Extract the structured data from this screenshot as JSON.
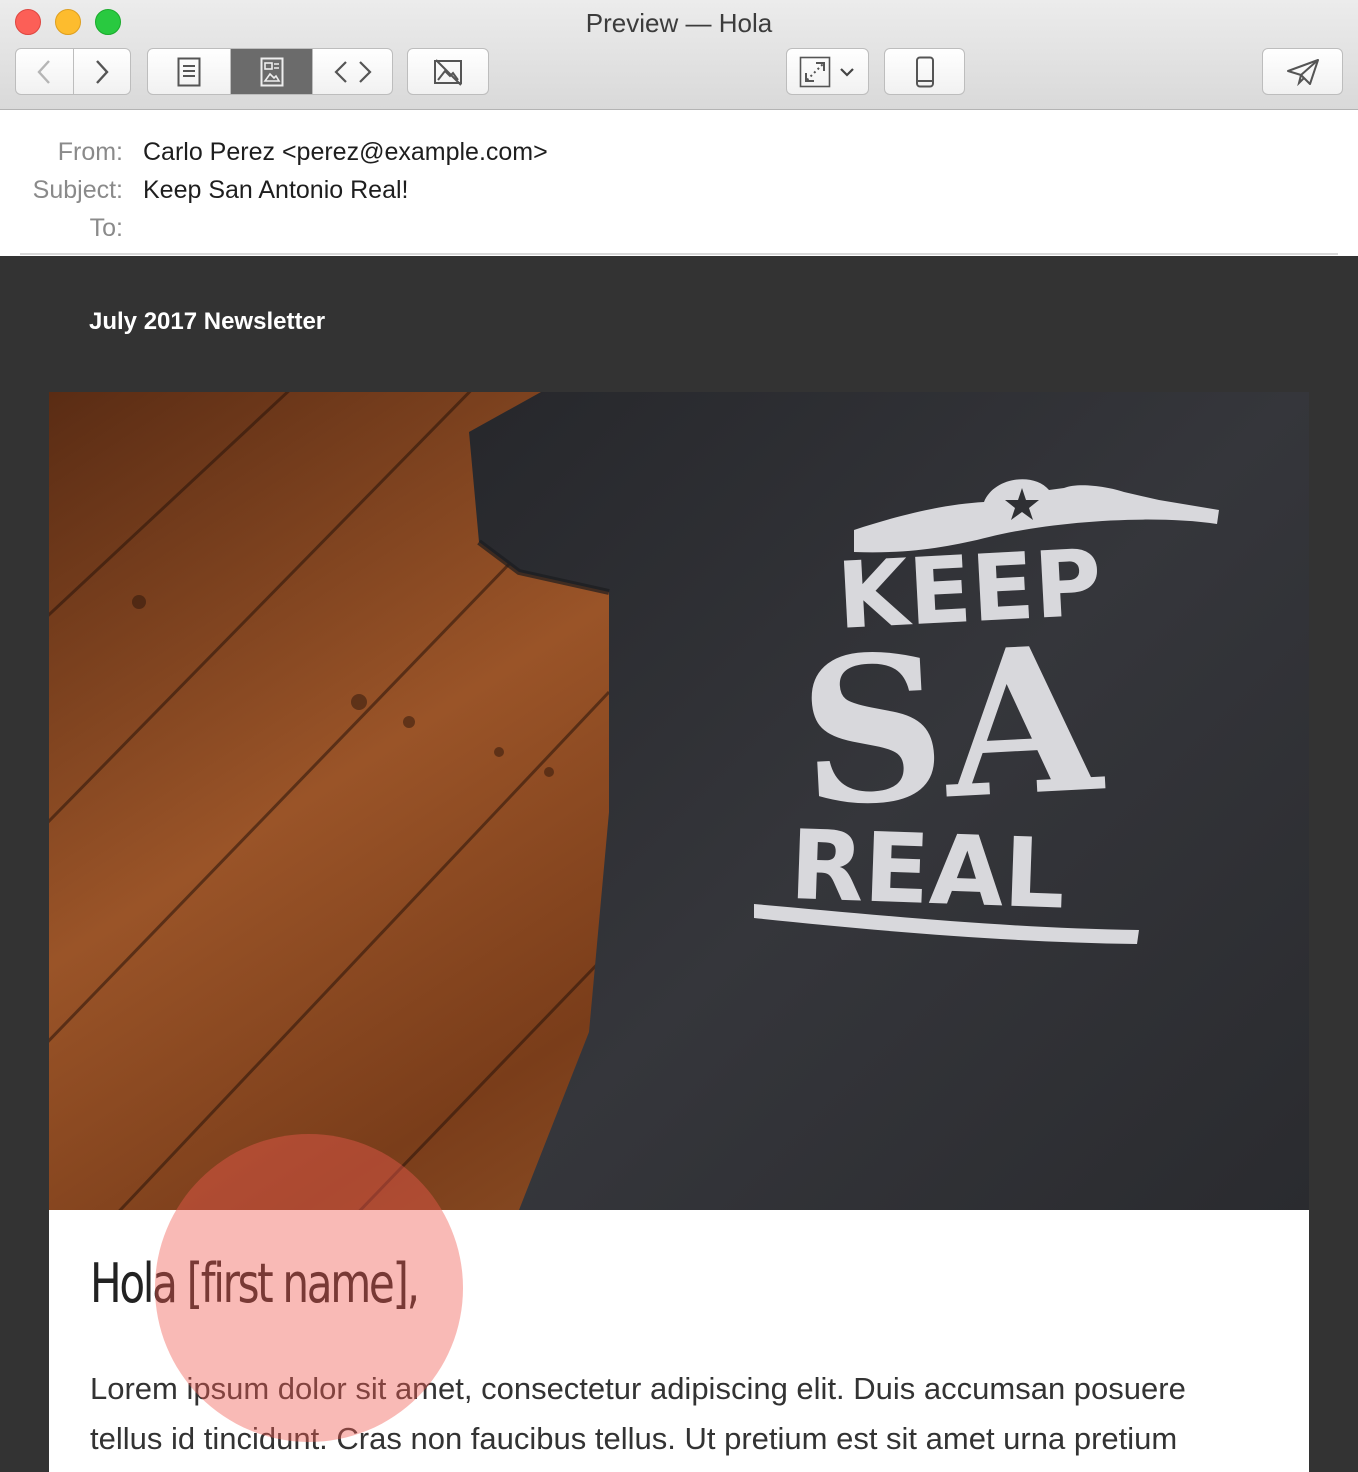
{
  "window": {
    "title": "Preview — Hola"
  },
  "toolbar": {
    "back_icon": "chevron-left-icon",
    "forward_icon": "chevron-right-icon",
    "view_modes": [
      "plain-text-icon",
      "rendered-view-icon",
      "source-code-icon"
    ],
    "active_view_mode": "rendered-view-icon",
    "hide_images_icon": "image-off-icon",
    "resize_icon": "expand-arrows-icon",
    "device_icon": "smartphone-icon",
    "send_icon": "paper-plane-icon"
  },
  "mail": {
    "from_label": "From:",
    "from_value": "Carlo Perez <perez@example.com>",
    "subject_label": "Subject:",
    "subject_value": "Keep San Antonio Real!",
    "to_label": "To:",
    "to_value": ""
  },
  "newsletter": {
    "issue_label": "July 2017 Newsletter",
    "hero_logo": {
      "line1": "KEEP",
      "line2": "SA",
      "line3": "REAL"
    },
    "greeting": "Hola [first name],",
    "paragraph": "Lorem ipsum dolor sit amet, consectetur adipiscing elit. Duis accumsan posuere tellus id tincidunt. Cras non faucibus tellus. Ut pretium est sit amet urna pretium"
  },
  "colors": {
    "newsletter_bg": "#333333",
    "card_bg": "#ffffff",
    "touch_spot": "#f05a50",
    "shirt": "#2c2d31",
    "shirt_print": "#d8d8dc",
    "wood": "#8a4a22"
  }
}
